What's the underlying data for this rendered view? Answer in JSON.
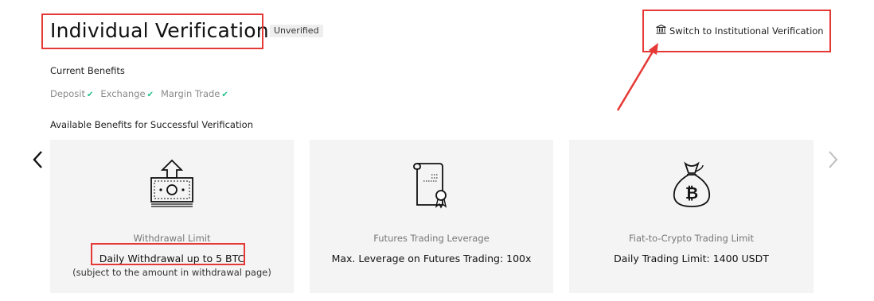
{
  "header": {
    "title": "Individual Verification",
    "status_badge": "Unverified",
    "switch_link": "Switch to Institutional Verification"
  },
  "current_benefits": {
    "label": "Current Benefits",
    "items": [
      "Deposit",
      "Exchange",
      "Margin Trade"
    ]
  },
  "available_benefits": {
    "label": "Available Benefits for Successful Verification",
    "cards": [
      {
        "icon": "withdrawal-icon",
        "label": "Withdrawal Limit",
        "value": "Daily Withdrawal up to 5 BTC",
        "note": "(subject to the amount in withdrawal page)"
      },
      {
        "icon": "certificate-icon",
        "label": "Futures Trading Leverage",
        "value": "Max. Leverage on Futures Trading: 100x"
      },
      {
        "icon": "bitcoin-bag-icon",
        "label": "Fiat-to-Crypto Trading Limit",
        "value": "Daily Trading Limit: 1400 USDT"
      }
    ]
  },
  "colors": {
    "highlight": "#e53935",
    "check": "#1dbf8a",
    "card_bg": "#f4f4f4"
  }
}
